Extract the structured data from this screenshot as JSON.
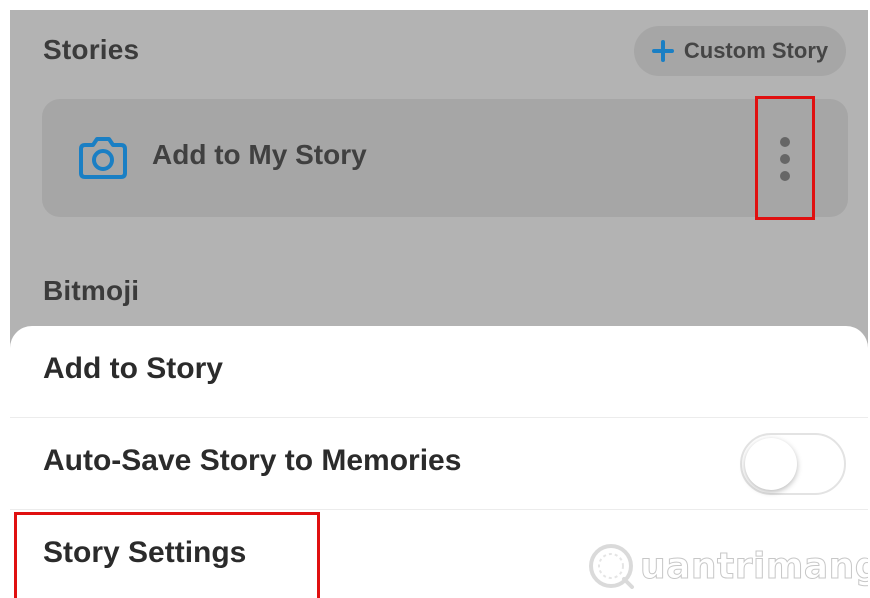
{
  "stories": {
    "title": "Stories",
    "custom_story_label": "Custom Story",
    "card_label": "Add to My Story",
    "icons": {
      "add": "plus-icon",
      "camera": "camera-icon",
      "more": "more-vertical-icon"
    }
  },
  "bitmoji": {
    "title": "Bitmoji"
  },
  "sheet": {
    "items": [
      {
        "label": "Add to Story"
      },
      {
        "label": "Auto-Save Story to Memories",
        "toggle": "off"
      },
      {
        "label": "Story Settings"
      }
    ]
  },
  "watermark": {
    "text": "uantrimang"
  },
  "colors": {
    "accent": "#1a7fc4",
    "highlight": "#e01010",
    "overlay": "#b3b3b3",
    "sheet_background": "#ffffff"
  }
}
